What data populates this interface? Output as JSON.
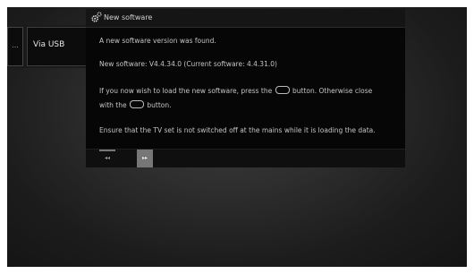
{
  "menu": {
    "collapsed_label": "...",
    "item_label": "Via USB"
  },
  "dialog": {
    "title": "New software",
    "line1": "A new software version was found.",
    "line2": "New software:  V4.4.34.0     (Current software:  4.4.31.0)",
    "line3_pre": "If you now wish to load the new software, press the",
    "line3_post": "button. Otherwise close",
    "line4_pre": "with the",
    "line4_post": "button.",
    "line5": "Ensure that the TV set is not switched off at the mains while it is loading the data.",
    "back_glyph": "◂◂",
    "forward_glyph": "▸▸"
  },
  "colors": {
    "background": "#2e2e2e",
    "dialog": "#060606",
    "forward_button": "#777777"
  },
  "icons": {
    "dialog_icon": "gear-icon"
  }
}
